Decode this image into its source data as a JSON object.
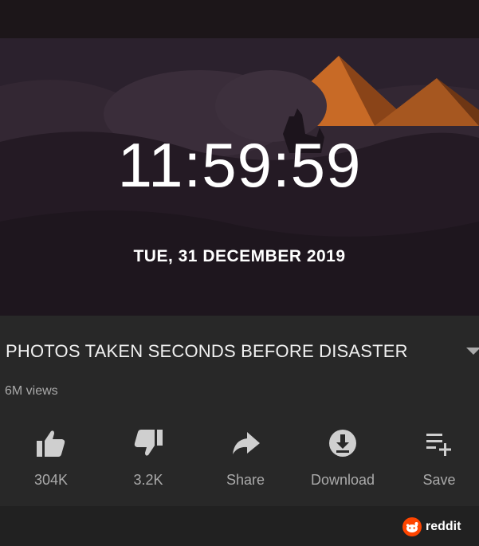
{
  "video": {
    "clock": "11:59:59",
    "date": "TUE, 31 DECEMBER 2019"
  },
  "details": {
    "title": "PHOTOS TAKEN SECONDS BEFORE DISASTER",
    "views": "6M views"
  },
  "actions": [
    {
      "icon": "thumbs-up-icon",
      "label": "304K"
    },
    {
      "icon": "thumbs-down-icon",
      "label": "3.2K"
    },
    {
      "icon": "share-icon",
      "label": "Share"
    },
    {
      "icon": "download-icon",
      "label": "Download"
    },
    {
      "icon": "save-playlist-icon",
      "label": "Save"
    }
  ],
  "watermark": {
    "text": "reddit"
  },
  "colors": {
    "background": "#212121",
    "text": "#f1f1f1",
    "secondary_text": "#aaaaaa",
    "reddit_orange": "#ff4500",
    "pyramid": "#c86a26"
  }
}
